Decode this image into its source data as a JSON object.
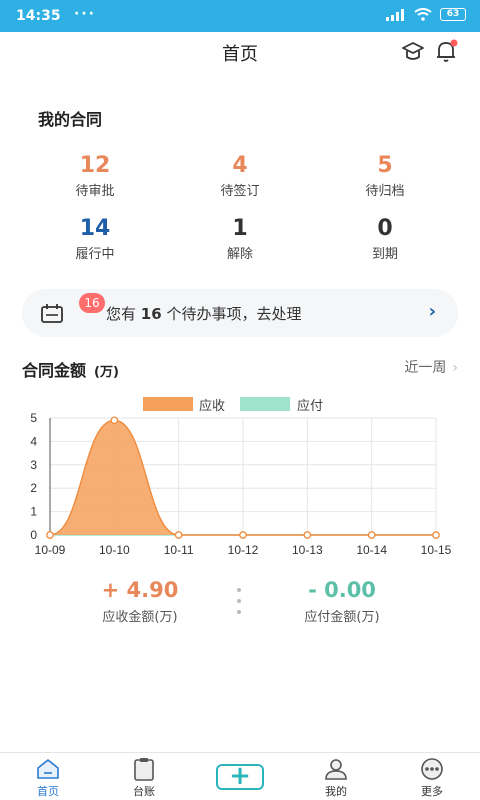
{
  "statusbar": {
    "time": "14:35",
    "dots": "···",
    "battery": "63"
  },
  "header": {
    "title": "首页"
  },
  "contracts": {
    "title": "我的合同",
    "stats": [
      {
        "value": "12",
        "label": "待审批",
        "color": "#e8875a"
      },
      {
        "value": "4",
        "label": "待签订",
        "color": "#e8875a"
      },
      {
        "value": "5",
        "label": "待归档",
        "color": "#e8875a"
      },
      {
        "value": "14",
        "label": "履行中",
        "color": "#1e5fa8"
      },
      {
        "value": "1",
        "label": "解除",
        "color": "#333333"
      },
      {
        "value": "0",
        "label": "到期",
        "color": "#333333"
      }
    ]
  },
  "todo": {
    "badge": "16",
    "prefix": "您有",
    "count": "16",
    "suffix": "个待办事项，去处理",
    "arrow": "›"
  },
  "amount": {
    "title": "合同金额",
    "unit": "(万)",
    "period": "近一周",
    "chev": "›"
  },
  "chart_data": {
    "type": "area",
    "x": [
      "10-09",
      "10-10",
      "10-11",
      "10-12",
      "10-13",
      "10-14",
      "10-15"
    ],
    "series": [
      {
        "name": "应收",
        "values": [
          0,
          4.9,
          0,
          0,
          0,
          0,
          0
        ],
        "color": "#f5a05a"
      },
      {
        "name": "应付",
        "values": [
          0,
          0,
          0,
          0,
          0,
          0,
          0
        ],
        "color": "#9fe3cc"
      }
    ],
    "ylim": [
      0,
      5
    ],
    "yticks": [
      "0",
      "1",
      "2",
      "3",
      "4",
      "5"
    ],
    "grid": true,
    "legend": "top-center"
  },
  "summary": {
    "receivable": {
      "value": "+ 4.90",
      "label": "应收金额(万)",
      "color": "#e8875a"
    },
    "payable": {
      "value": "- 0.00",
      "label": "应付金额(万)",
      "color": "#5cbfa8"
    }
  },
  "tabs": [
    {
      "label": "首页",
      "icon": "home-icon",
      "active": true
    },
    {
      "label": "台账",
      "icon": "clipboard-icon"
    },
    {
      "label": "",
      "icon": "plus-icon"
    },
    {
      "label": "我的",
      "icon": "user-icon"
    },
    {
      "label": "更多",
      "icon": "more-icon"
    }
  ]
}
